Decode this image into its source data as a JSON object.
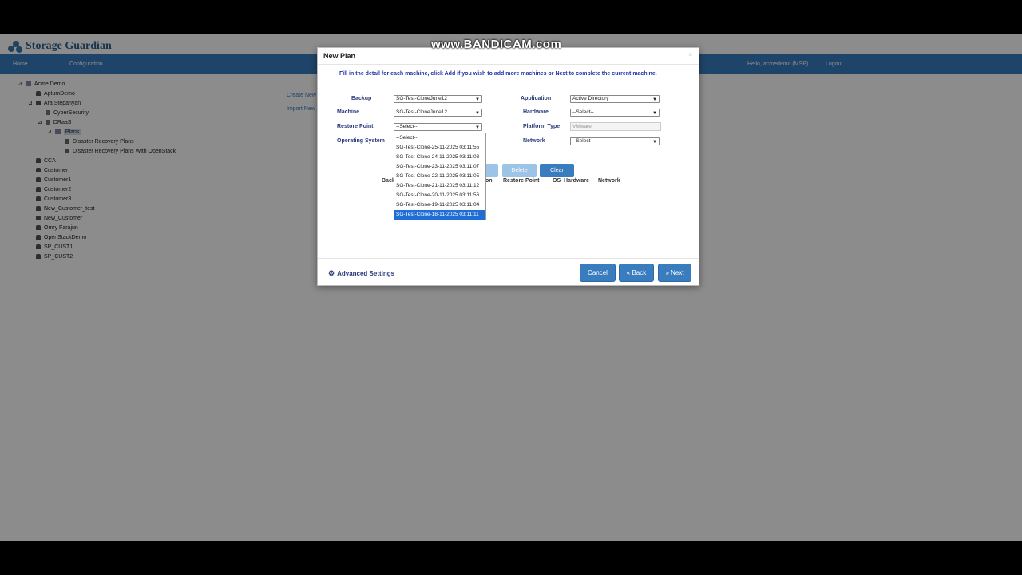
{
  "brand": {
    "name": "Storage Guardian"
  },
  "nav": {
    "home": "Home",
    "configuration": "Configuration",
    "user": "Hello, acmedemo (MSP)",
    "logout": "Logout"
  },
  "tree": {
    "root": "Acme Demo",
    "items": [
      "AptumDemo",
      "Ara Stepanyan",
      "CyberSecurity",
      "DRaaS",
      "Plans",
      "Disaster Recovery Plans",
      "Disaster Recovery Plans With OpenStack",
      "CCA",
      "Customer",
      "Customer1",
      "Customer2",
      "Customer3",
      "New_Customer_test",
      "New_Customer",
      "Omry Farajun",
      "OpenStackDemo",
      "SP_CUST1",
      "SP_CUST2"
    ]
  },
  "background_links": {
    "create": "Create New",
    "import": "Import New"
  },
  "modal": {
    "title": "New Plan",
    "close": "×",
    "instructions": "Fill in the detail for each machine, click Add if you wish to add more machines or Next to complete the current machine.",
    "labels": {
      "backup": "Backup",
      "machine": "Machine",
      "restore_point": "Restore Point",
      "operating_system": "Operating System",
      "application": "Application",
      "hardware": "Hardware",
      "platform_type": "Platform Type",
      "network": "Network"
    },
    "values": {
      "backup": "SG-Test-CloneJune12",
      "machine": "SG-Test-CloneJune12",
      "restore_point": "--Select--",
      "application": "Active Directory",
      "hardware": "--Select--",
      "platform_type": "VMware",
      "network": "--Select--"
    },
    "restore_options": [
      "--Select--",
      "SG-Test-Clone-25-11-2025 03:11:55",
      "SG-Test-Clone-24-11-2025 03:11:03",
      "SG-Test-Clone-23-11-2025 03:11:07",
      "SG-Test-Clone-22-11-2025 03:11:05",
      "SG-Test-Clone-21-11-2025 03:11:12",
      "SG-Test-Clone-20-11-2025 03:11:56",
      "SG-Test-Clone-19-11-2025 03:11:04",
      "SG-Test-Clone-18-11-2025 03:11:11"
    ],
    "restore_selected_index": 8,
    "buttons": {
      "delete": "Delete",
      "clear": "Clear"
    },
    "columns": {
      "backup": "Back",
      "application": "on",
      "restore_point": "Restore Point",
      "os": "OS",
      "hardware": "Hardware",
      "network": "Network"
    },
    "advanced": "Advanced Settings",
    "footer": {
      "cancel": "Cancel",
      "back": "« Back",
      "next": "» Next"
    }
  },
  "watermark": "www.BANDICAM.com",
  "colors": {
    "navbar": "#3a7dbf",
    "primary_button": "#3a7dbf",
    "selected_option": "#1e6ed6"
  }
}
